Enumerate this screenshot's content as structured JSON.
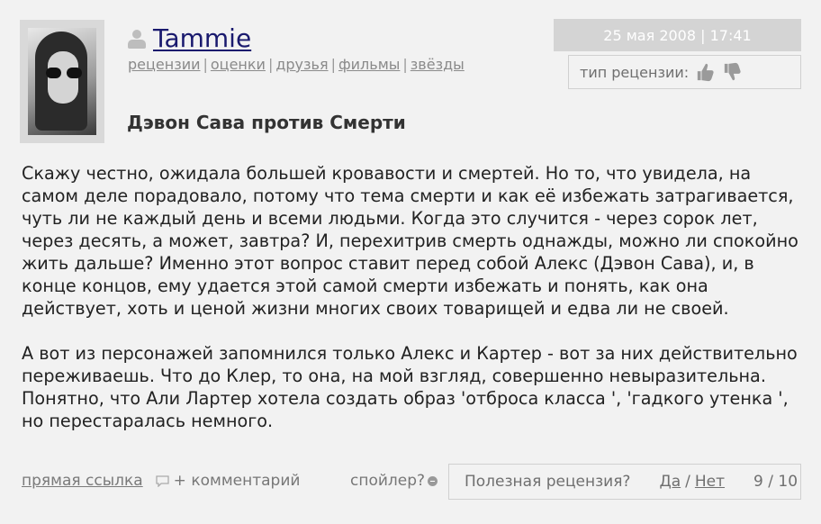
{
  "user": {
    "name": "Tammie",
    "links": [
      "рецензии",
      "оценки",
      "друзья",
      "фильмы",
      "звёзды"
    ]
  },
  "review": {
    "title": "Дэвон Сава против Смерти",
    "date": "25 мая 2008 | 17:41",
    "type_label": "тип рецензии:",
    "paragraphs": [
      "Скажу честно, ожидала большей кровавости и смертей. Но то, что увидела, на самом деле порадовало, потому что тема смерти и как её избежать затрагивается, чуть ли не каждый день и всеми людьми. Когда это случится - через сорок лет, через десять, а может, завтра? И, перехитрив смерть однажды, можно ли спокойно жить дальше? Именно этот вопрос ставит перед собой Алекс (Дэвон Сава), и, в конце концов, ему удается этой самой смерти избежать и понять, как она действует, хоть и ценой жизни многих своих товарищей и едва ли не своей.",
      "А вот из персонажей запомнился только Алекс и Картер - вот за них действительно переживаешь. Что до Клер, то она, на мой взгляд, совершенно невыразительна. Понятно, что Али Лартер хотела создать образ 'отброса класса ', 'гадкого утенка ', но перестаралась немного."
    ]
  },
  "footer": {
    "permalink": "прямая ссылка",
    "comment": "+ комментарий",
    "spoiler": "спойлер?",
    "useful_question": "Полезная рецензия?",
    "yes": "Да",
    "no": "Нет",
    "score": "9 / 10"
  },
  "colors": {
    "username": "#1a1a6e",
    "date_bar": "#d4d4d4",
    "background": "#f2f2f2"
  }
}
